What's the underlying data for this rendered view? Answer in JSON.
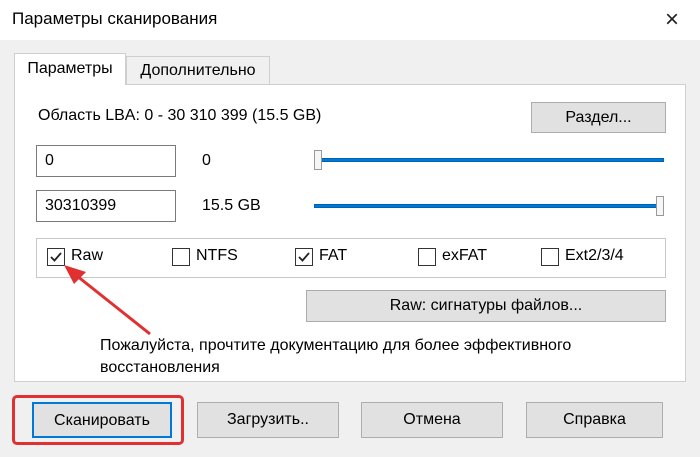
{
  "window": {
    "title": "Параметры сканирования",
    "close_glyph": "×"
  },
  "tabs": [
    {
      "label": "Параметры",
      "active": true
    },
    {
      "label": "Дополнительно",
      "active": false
    }
  ],
  "lba": {
    "area_label": "Область LBA: 0 - 30 310 399 (15.5 GB)",
    "section_button": "Раздел...",
    "start_value": "0",
    "start_display": "0",
    "start_position": 0,
    "end_value": "30310399",
    "end_display": "15.5 GB",
    "end_position": 1
  },
  "filesystems": [
    {
      "label": "Raw",
      "checked": true
    },
    {
      "label": "NTFS",
      "checked": false
    },
    {
      "label": "FAT",
      "checked": true
    },
    {
      "label": "exFAT",
      "checked": false
    },
    {
      "label": "Ext2/3/4",
      "checked": false
    }
  ],
  "raw_signatures_button": "Raw: сигнатуры файлов...",
  "note": "Пожалуйста, прочтите документацию для более эффективного восстановления",
  "buttons": {
    "scan": "Сканировать",
    "load": "Загрузить..",
    "cancel": "Отмена",
    "help": "Справка"
  },
  "colors": {
    "annotation": "#e03030",
    "slider": "#0078d7"
  }
}
